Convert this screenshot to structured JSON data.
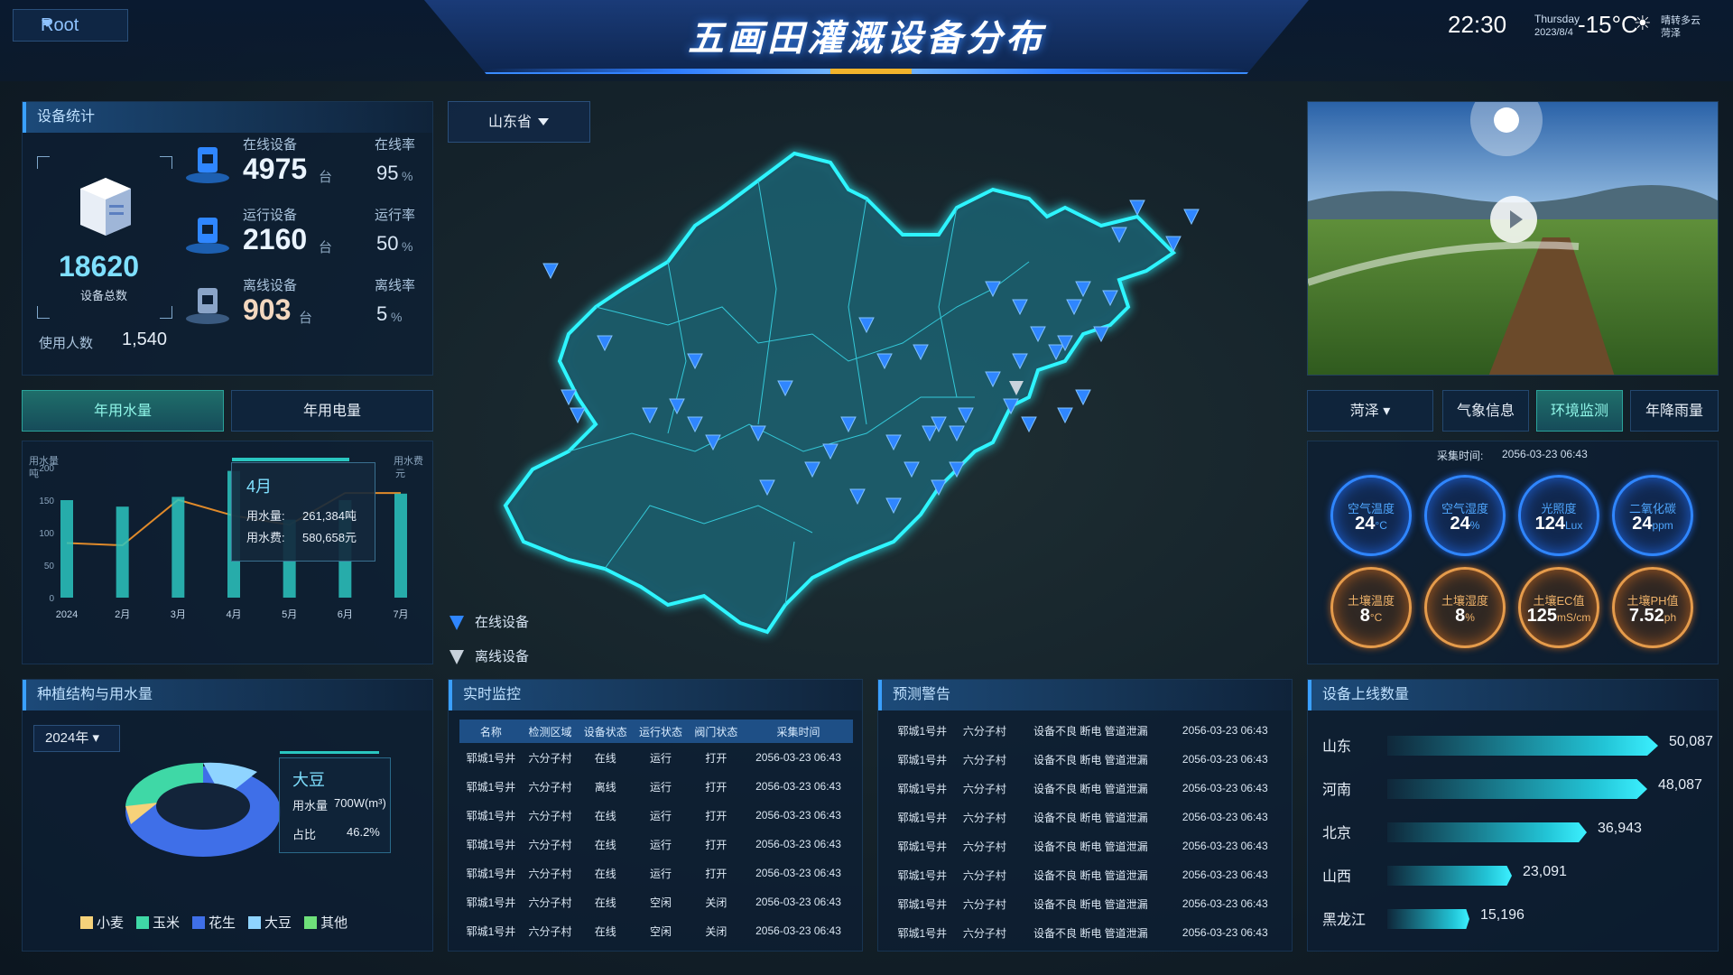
{
  "header": {
    "title": "五画田灌溉设备分布",
    "root_label": "Root",
    "time": "22:30",
    "weekday": "Thursday",
    "date": "2023/8/4",
    "temperature": "-15°C",
    "weather": "晴转多云",
    "city": "菏泽"
  },
  "devices": {
    "title": "设备统计",
    "total": "18620",
    "total_label": "设备总数",
    "users_label": "使用人数",
    "users_value": "1,540",
    "rows": [
      {
        "label": "在线设备",
        "value": "4975",
        "unit": "台",
        "rate_label": "在线率",
        "rate": "95",
        "pct": "%"
      },
      {
        "label": "运行设备",
        "value": "2160",
        "unit": "台",
        "rate_label": "运行率",
        "rate": "50",
        "pct": "%"
      },
      {
        "label": "离线设备",
        "value": "903",
        "unit": "台",
        "rate_label": "离线率",
        "rate": "5",
        "pct": "%"
      }
    ]
  },
  "water": {
    "tab_water": "年用水量",
    "tab_power": "年用电量",
    "ylabel_left": "用水量",
    "ylabel_left_unit": "吨",
    "ylabel_right": "用水费",
    "ylabel_right_unit": "元",
    "tooltip": {
      "month": "4月",
      "usage_label": "用水量:",
      "usage": "261,384吨",
      "fee_label": "用水费:",
      "fee": "580,658元"
    }
  },
  "chart_data": {
    "type": "bar",
    "categories": [
      "2024",
      "2月",
      "3月",
      "4月",
      "5月",
      "6月",
      "7月"
    ],
    "yticks": [
      "0",
      "50",
      "100",
      "150",
      "200"
    ],
    "ylim": [
      0,
      200
    ],
    "series": [
      {
        "type": "bar",
        "values": [
          150,
          140,
          155,
          195,
          120,
          150,
          160
        ]
      },
      {
        "type": "line",
        "values": [
          120,
          115,
          215,
          180,
          160,
          290,
          305
        ]
      }
    ],
    "bar_color": "#2cc6c0",
    "line_color": "#e08a2a"
  },
  "map": {
    "province": "山东省",
    "legend_online": "在线设备",
    "legend_offline": "离线设备"
  },
  "crop": {
    "title": "种植结构与用水量",
    "year": "2024年",
    "detail_name": "大豆",
    "usage_label": "用水量",
    "usage_value": "700W(m³)",
    "share_label": "占比",
    "share_value": "46.2%",
    "legend": [
      {
        "name": "小麦",
        "color": "#f6d27a"
      },
      {
        "name": "玉米",
        "color": "#3fd8a6"
      },
      {
        "name": "花生",
        "color": "#3f6fe8"
      },
      {
        "name": "大豆",
        "color": "#8fd4ff"
      },
      {
        "name": "其他",
        "color": "#6ee07a"
      }
    ]
  },
  "monitor": {
    "title": "实时监控",
    "headers": [
      "名称",
      "检测区域",
      "设备状态",
      "运行状态",
      "阀门状态",
      "采集时间"
    ],
    "rows": [
      [
        "郓城1号井",
        "六分子村",
        "在线",
        "运行",
        "打开",
        "2056-03-23 06:43"
      ],
      [
        "郓城1号井",
        "六分子村",
        "离线",
        "运行",
        "打开",
        "2056-03-23 06:43"
      ],
      [
        "郓城1号井",
        "六分子村",
        "在线",
        "运行",
        "打开",
        "2056-03-23 06:43"
      ],
      [
        "郓城1号井",
        "六分子村",
        "在线",
        "运行",
        "打开",
        "2056-03-23 06:43"
      ],
      [
        "郓城1号井",
        "六分子村",
        "在线",
        "运行",
        "打开",
        "2056-03-23 06:43"
      ],
      [
        "郓城1号井",
        "六分子村",
        "在线",
        "空闲",
        "关闭",
        "2056-03-23 06:43"
      ],
      [
        "郓城1号井",
        "六分子村",
        "在线",
        "空闲",
        "关闭",
        "2056-03-23 06:43"
      ]
    ]
  },
  "warning": {
    "title": "预测警告",
    "rows": [
      [
        "郓城1号井",
        "六分子村",
        "设备不良 断电 管道泄漏",
        "2056-03-23 06:43"
      ],
      [
        "郓城1号井",
        "六分子村",
        "设备不良 断电 管道泄漏",
        "2056-03-23 06:43"
      ],
      [
        "郓城1号井",
        "六分子村",
        "设备不良 断电 管道泄漏",
        "2056-03-23 06:43"
      ],
      [
        "郓城1号井",
        "六分子村",
        "设备不良 断电 管道泄漏",
        "2056-03-23 06:43"
      ],
      [
        "郓城1号井",
        "六分子村",
        "设备不良 断电 管道泄漏",
        "2056-03-23 06:43"
      ],
      [
        "郓城1号井",
        "六分子村",
        "设备不良 断电 管道泄漏",
        "2056-03-23 06:43"
      ],
      [
        "郓城1号井",
        "六分子村",
        "设备不良 断电 管道泄漏",
        "2056-03-23 06:43"
      ],
      [
        "郓城1号井",
        "六分子村",
        "设备不良 断电 管道泄漏",
        "2056-03-23 06:43"
      ]
    ]
  },
  "env": {
    "city": "菏泽",
    "tab_weather": "气象信息",
    "tab_env": "环境监测",
    "tab_rain": "年降雨量",
    "collect_label": "采集时间:",
    "collect_time": "2056-03-23 06:43",
    "gauges_top": [
      {
        "label": "空气温度",
        "value": "24",
        "unit": "°C"
      },
      {
        "label": "空气湿度",
        "value": "24",
        "unit": "%"
      },
      {
        "label": "光照度",
        "value": "124",
        "unit": "Lux"
      },
      {
        "label": "二氧化碳",
        "value": "24",
        "unit": "ppm"
      }
    ],
    "gauges_bottom": [
      {
        "label": "土壤温度",
        "value": "8",
        "unit": "°C"
      },
      {
        "label": "土壤湿度",
        "value": "8",
        "unit": "%"
      },
      {
        "label": "土壤EC值",
        "value": "125",
        "unit": "mS/cm"
      },
      {
        "label": "土壤PH值",
        "value": "7.52",
        "unit": "ph"
      }
    ]
  },
  "online": {
    "title": "设备上线数量",
    "rows": [
      {
        "name": "山东",
        "value": "50,087",
        "num": 50087
      },
      {
        "name": "河南",
        "value": "48,087",
        "num": 48087
      },
      {
        "name": "北京",
        "value": "36,943",
        "num": 36943
      },
      {
        "name": "山西",
        "value": "23,091",
        "num": 23091
      },
      {
        "name": "黑龙江",
        "value": "15,196",
        "num": 15196
      }
    ]
  }
}
